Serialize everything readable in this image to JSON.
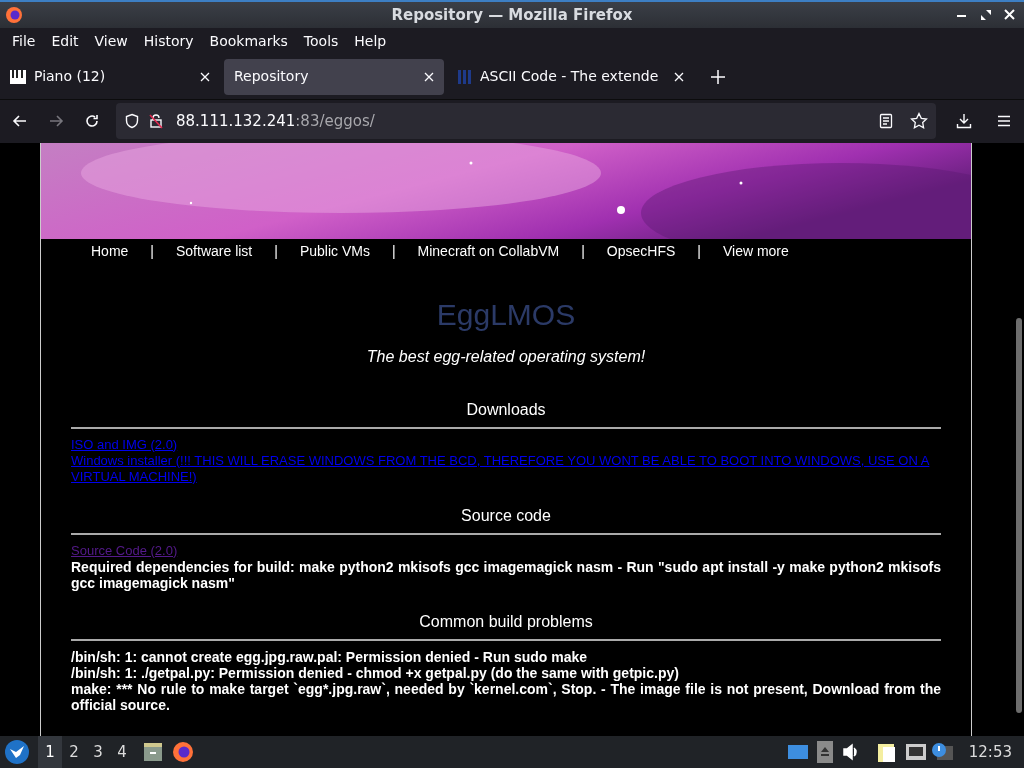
{
  "window": {
    "title": "Repository — Mozilla Firefox"
  },
  "menu": [
    "File",
    "Edit",
    "View",
    "History",
    "Bookmarks",
    "Tools",
    "Help"
  ],
  "tabs": [
    {
      "label": "Piano (12)",
      "selected": false,
      "kind": "piano"
    },
    {
      "label": "Repository",
      "selected": true,
      "kind": "none"
    },
    {
      "label": "ASCII Code - The extende",
      "selected": false,
      "kind": "ascii"
    }
  ],
  "address": {
    "host": "88.111.132.241",
    "rest": ":83/eggos/"
  },
  "page": {
    "nav": {
      "separator": "|",
      "links": [
        "Home",
        "Software list",
        "Public VMs",
        "Minecraft on CollabVM",
        "OpsecHFS",
        "View more"
      ]
    },
    "title": "EggLMOS",
    "subtitle": "The best egg-related operating system!",
    "sections": [
      {
        "heading": "Downloads",
        "links": [
          {
            "text": "ISO and IMG (2.0)",
            "visited": false
          },
          {
            "text": "Windows installer (!!! THIS WILL ERASE WINDOWS FROM THE BCD, THEREFORE YOU WONT BE ABLE TO BOOT INTO WINDOWS, USE ON A VIRTUAL MACHINE!)",
            "visited": false
          }
        ]
      },
      {
        "heading": "Source code",
        "links": [
          {
            "text": "Source Code (2.0)",
            "visited": true
          }
        ],
        "notes": [
          "Required dependencies for build: make python2 mkisofs gcc imagemagick nasm - Run \"sudo apt install -y make python2 mkisofs gcc imagemagick nasm\""
        ]
      },
      {
        "heading": "Common build problems",
        "notes": [
          "/bin/sh: 1: cannot create egg.jpg.raw.pal: Permission denied - Run sudo make",
          "/bin/sh: 1: ./getpal.py: Permission denied - chmod +x getpal.py (do the same with getpic.py)",
          "make: *** No rule to make target `egg*.jpg.raw`, needed by `kernel.com`, Stop. - The image file is not present, Download from the official source."
        ]
      }
    ]
  },
  "taskbar": {
    "workspaces": [
      {
        "label": "1",
        "selected": true
      },
      {
        "label": "2",
        "selected": false
      },
      {
        "label": "3",
        "selected": false
      },
      {
        "label": "4",
        "selected": false
      }
    ],
    "clock": "12:53"
  }
}
